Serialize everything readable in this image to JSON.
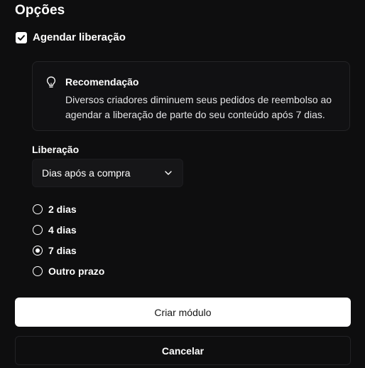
{
  "section": {
    "title": "Opções"
  },
  "schedule": {
    "label": "Agendar liberação",
    "checked": true
  },
  "tip": {
    "icon": "lightbulb-icon",
    "title": "Recomendação",
    "text": "Diversos criadores diminuem seus pedidos de reembolso ao agendar a liberação de parte do seu conteúdo após 7 dias."
  },
  "release": {
    "label": "Liberação",
    "selected": "Dias após a compra",
    "options": [
      {
        "label": "2 dias",
        "checked": false
      },
      {
        "label": "4 dias",
        "checked": false
      },
      {
        "label": "7 dias",
        "checked": true
      },
      {
        "label": "Outro prazo",
        "checked": false
      }
    ]
  },
  "actions": {
    "create": "Criar módulo",
    "cancel": "Cancelar"
  },
  "colors": {
    "background": "#0e0e0f",
    "primary_button": "#ffffff",
    "text": "#ffffff"
  }
}
